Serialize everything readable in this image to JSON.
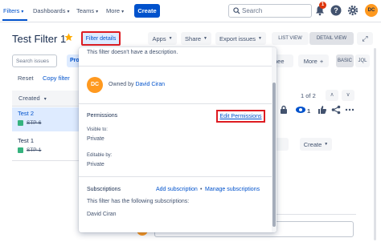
{
  "nav": {
    "filters": "Filters",
    "dashboards": "Dashboards",
    "teams": "Teams",
    "more": "More",
    "create": "Create",
    "search_placeholder": "Search",
    "notification_count": "1",
    "avatar_initials": "DC"
  },
  "header": {
    "title": "Test Filter 1",
    "filter_details": "Filter details",
    "apps": "Apps",
    "share": "Share",
    "export": "Export issues",
    "list_view": "LIST VIEW",
    "detail_view": "DETAIL VIEW"
  },
  "left": {
    "search_placeholder": "Search issues",
    "pro_partial": "Pro",
    "reset": "Reset",
    "copy_filter": "Copy filter",
    "sort_header": "Created",
    "rows": [
      {
        "title": "Test 2",
        "key": "STP-6"
      },
      {
        "title": "Test 1",
        "key": "STP-1"
      }
    ]
  },
  "right_bg": {
    "seg_a_partial": "nee",
    "more": "More",
    "basic": "BASIC",
    "jql": "JQL",
    "pager": "1 of 2",
    "watch_count": "1",
    "seg_b_partial": "e",
    "create": "Create"
  },
  "popup": {
    "no_description": "This filter doesn't have a description.",
    "owner_initials": "DC",
    "owned_by_label": "Owned by",
    "owner_name": "David Ciran",
    "permissions_heading": "Permissions",
    "edit_permissions": "Edit Permissions",
    "visible_to_label": "Visible to:",
    "visible_to_value": "Private",
    "editable_by_label": "Editable by:",
    "editable_by_value": "Private",
    "subscriptions_heading": "Subscriptions",
    "add_subscription": "Add subscription",
    "bullet": "•",
    "manage_subscriptions": "Manage subscriptions",
    "subscriptions_text": "This filter has the following subscriptions:",
    "subscriber": "David Ciran"
  },
  "colors": {
    "brand": "#0052cc",
    "highlight": "#de1c22",
    "avatar": "#ff991f",
    "issue_type": "#36b37e"
  }
}
